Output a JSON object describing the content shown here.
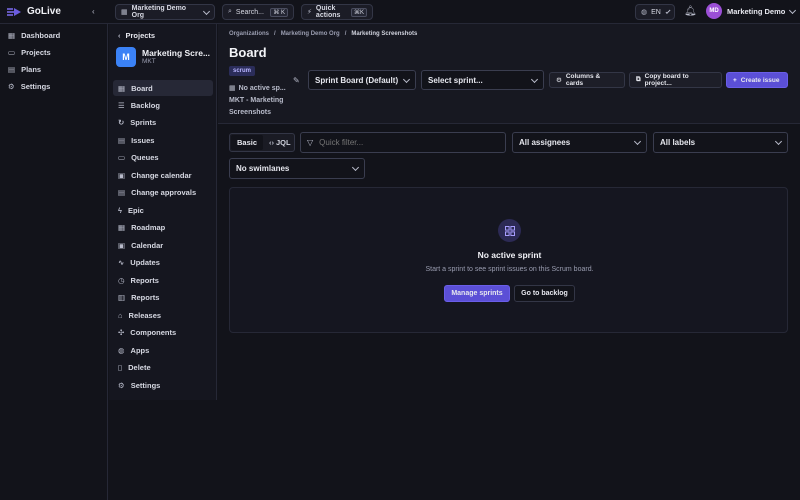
{
  "app": {
    "name": "GoLive"
  },
  "topbar": {
    "org": "Marketing Demo Org",
    "search_label": "Search...",
    "search_kbd": "⌘ K",
    "quick_actions": "Quick actions",
    "quick_kbd": "⌘K",
    "lang": "EN",
    "user_initials": "MD",
    "user_name": "Marketing Demo"
  },
  "sidebar": {
    "items": [
      {
        "label": "Dashboard",
        "icon": "grid-icon"
      },
      {
        "label": "Projects",
        "icon": "folder-icon"
      },
      {
        "label": "Plans",
        "icon": "file-icon"
      },
      {
        "label": "Settings",
        "icon": "gear-icon"
      }
    ]
  },
  "project": {
    "back_label": "Projects",
    "avatar": "M",
    "name": "Marketing Scre...",
    "key": "MKT",
    "nav": [
      {
        "label": "Board",
        "active": true
      },
      {
        "label": "Backlog"
      },
      {
        "label": "Sprints"
      },
      {
        "label": "Issues"
      },
      {
        "label": "Queues"
      },
      {
        "label": "Change calendar"
      },
      {
        "label": "Change approvals"
      },
      {
        "label": "Epic"
      },
      {
        "label": "Roadmap"
      },
      {
        "label": "Calendar"
      },
      {
        "label": "Updates"
      },
      {
        "label": "Reports"
      },
      {
        "label": "Reports"
      },
      {
        "label": "Releases"
      },
      {
        "label": "Components"
      },
      {
        "label": "Apps"
      },
      {
        "label": "Delete"
      },
      {
        "label": "Settings"
      }
    ]
  },
  "breadcrumb": [
    "Organizations",
    "Marketing Demo Org",
    "Marketing Screenshots"
  ],
  "board": {
    "title": "Board",
    "badge": "scrum",
    "sprint_line1": "No active sp...",
    "sprint_line2": "MKT - Marketing",
    "sprint_line3": "Screenshots",
    "board_select": "Sprint Board (Default)",
    "sprint_select": "Select sprint...",
    "columns_btn": "Columns & cards",
    "copy_btn": "Copy board to project...",
    "create_btn": "Create issue"
  },
  "filters": {
    "basic": "Basic",
    "jql": "JQL",
    "quick_placeholder": "Quick filter...",
    "assignees": "All assignees",
    "labels": "All labels",
    "swimlanes": "No swimlanes"
  },
  "empty": {
    "title": "No active sprint",
    "subtitle": "Start a sprint to see sprint issues on this Scrum board.",
    "manage_btn": "Manage sprints",
    "backlog_btn": "Go to backlog"
  },
  "colors": {
    "accent": "#5b4fd6",
    "avatar": "#3b82f6",
    "user": "#9b4fd6"
  }
}
